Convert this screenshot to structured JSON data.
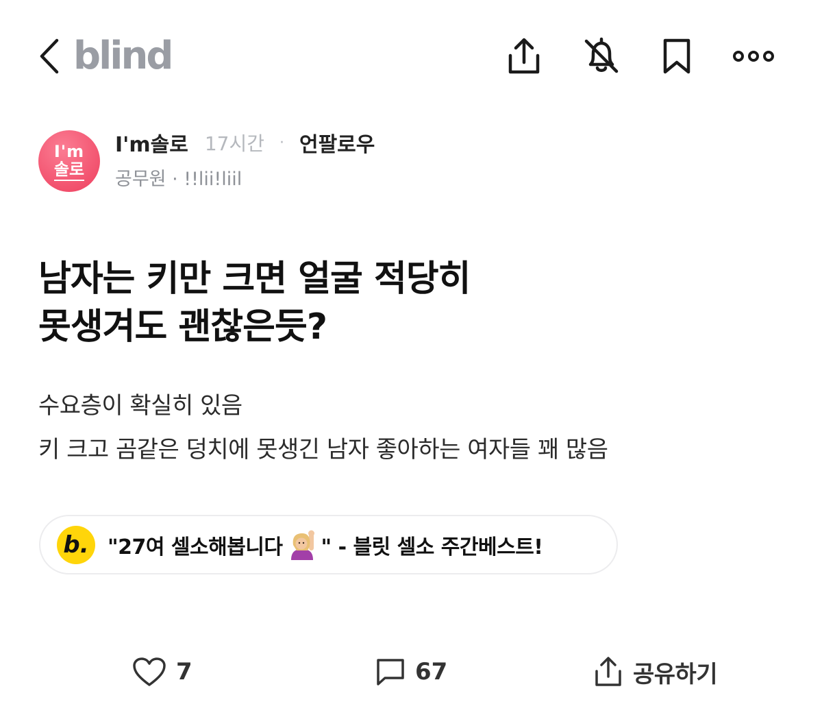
{
  "header": {
    "brand": "blind",
    "icons": [
      "chevron-left-icon",
      "share-icon",
      "bell-off-icon",
      "bookmark-icon",
      "more-icon"
    ]
  },
  "author": {
    "avatar_line1": "I'm",
    "avatar_line2": "솔로",
    "name": "I'm솔로",
    "time": "17시간",
    "separator": "·",
    "unfollow_label": "언팔로우",
    "affiliation": "공무원 · !!lii!liil",
    "avatar_color": "#ef4b68"
  },
  "post": {
    "title_lines": [
      "남자는 키만 크면 얼굴 적당히",
      "못생겨도 괜찮은듯?"
    ],
    "body_lines": [
      "수요층이 확실히 있음",
      "키 크고 곰같은 덩치에 못생긴 남자 좋아하는 여자들 꽤 많음"
    ]
  },
  "promo": {
    "logo": "b.",
    "text_before": "\"27여 셀소해봅니다",
    "text_after": "\" - 블릿 셀소 주간베스트!",
    "logo_color": "#ffd50a"
  },
  "footer": {
    "like_count": "7",
    "comment_count": "67",
    "share_label": "공유하기"
  }
}
